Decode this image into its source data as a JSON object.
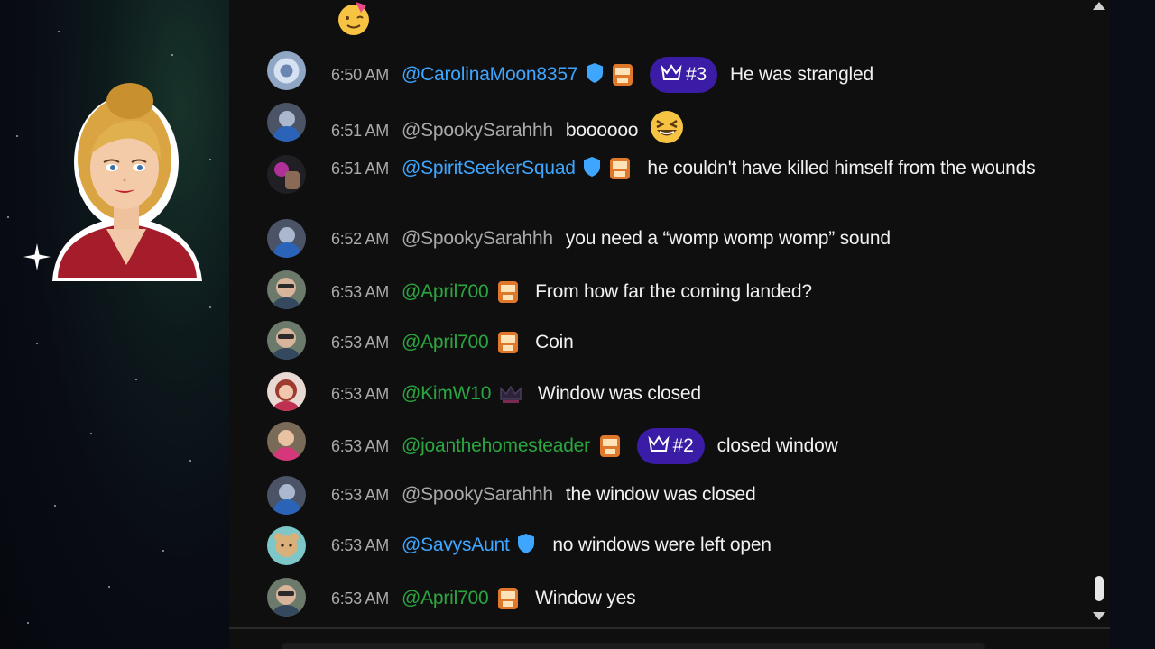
{
  "colors": {
    "chat_bg": "#0f0f0f",
    "timestamp": "#aaaaaa",
    "member_blue": "#3ea6ff",
    "member_green": "#2ba640",
    "message_text": "#f1f1f1",
    "crown_badge": "#3a1ca6"
  },
  "icons": {
    "verified": "shield-check-icon",
    "membership_badge": "wat-badge-icon",
    "crown": "crown-icon",
    "scroll_up": "triangle-up-icon",
    "scroll_down": "triangle-down-icon",
    "sparkle": "sparkle-icon"
  },
  "messages": [
    {
      "time": "6:50 AM",
      "user": "@CarolinaMoon8357",
      "rank": "#3",
      "text": "He was strangled"
    },
    {
      "time": "6:51 AM",
      "user": "@SpookySarahhh",
      "text": "boooooo"
    },
    {
      "time": "6:51 AM",
      "user": "@SpiritSeekerSquad",
      "text": "he couldn't have killed himself from the wounds"
    },
    {
      "time": "6:52 AM",
      "user": "@SpookySarahhh",
      "text": "you need a “womp womp womp” sound"
    },
    {
      "time": "6:53 AM",
      "user": "@April700",
      "text": "From how far the coming landed?"
    },
    {
      "time": "6:53 AM",
      "user": "@April700",
      "text": "Coin"
    },
    {
      "time": "6:53 AM",
      "user": "@KimW10",
      "text": "Window was closed"
    },
    {
      "time": "6:53 AM",
      "user": "@joanthehomesteader",
      "rank": "#2",
      "text": "closed window"
    },
    {
      "time": "6:53 AM",
      "user": "@SpookySarahhh",
      "text": "the window was closed"
    },
    {
      "time": "6:53 AM",
      "user": "@SavysAunt",
      "text": "no windows were left open"
    },
    {
      "time": "6:53 AM",
      "user": "@April700",
      "text": "Window yes"
    }
  ]
}
